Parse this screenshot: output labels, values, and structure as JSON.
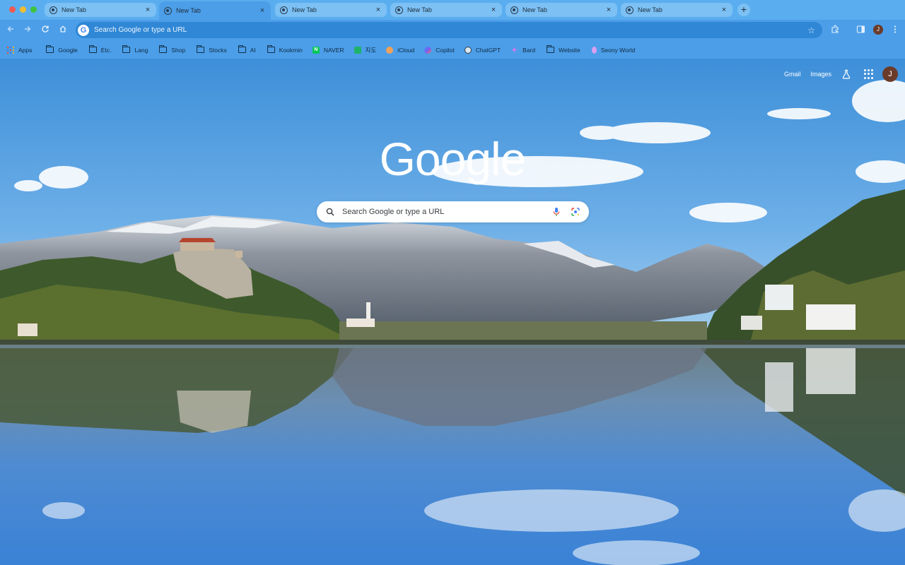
{
  "window": {
    "tabs": [
      {
        "title": "New Tab",
        "active": false
      },
      {
        "title": "New Tab",
        "active": true
      },
      {
        "title": "New Tab",
        "active": false
      },
      {
        "title": "New Tab",
        "active": false
      },
      {
        "title": "New Tab",
        "active": false
      },
      {
        "title": "New Tab",
        "active": false
      }
    ],
    "close_glyph": "×",
    "new_tab_glyph": "+"
  },
  "toolbar": {
    "omnibox_placeholder": "Search Google or type a URL",
    "omnibox_badge": "G",
    "profile_initial": "J"
  },
  "bookmarks": [
    {
      "label": "Apps",
      "icon": "apps-grid-icon"
    },
    {
      "label": "Google",
      "icon": "folder-icon"
    },
    {
      "label": "Etc.",
      "icon": "folder-icon"
    },
    {
      "label": "Lang",
      "icon": "folder-icon"
    },
    {
      "label": "Shop",
      "icon": "folder-icon"
    },
    {
      "label": "Stocks",
      "icon": "folder-icon"
    },
    {
      "label": "AI",
      "icon": "folder-icon"
    },
    {
      "label": "Kookmin",
      "icon": "folder-icon"
    },
    {
      "label": "NAVER",
      "icon": "naver-icon",
      "color": "#03c75a"
    },
    {
      "label": "지도",
      "icon": "naver-map-icon",
      "color": "#1fb26b"
    },
    {
      "label": "iCloud",
      "icon": "icloud-icon",
      "color": "#f0a25a"
    },
    {
      "label": "Copilot",
      "icon": "copilot-icon",
      "color": "#7a5cf0"
    },
    {
      "label": "ChatGPT",
      "icon": "chatgpt-icon",
      "color": "#2f3b45"
    },
    {
      "label": "Bard",
      "icon": "bard-icon",
      "color": "#c27cf0"
    },
    {
      "label": "Website",
      "icon": "folder-icon"
    },
    {
      "label": "Seony World",
      "icon": "seony-world-icon",
      "color": "#d9a0f0"
    }
  ],
  "ntp": {
    "links": {
      "gmail": "Gmail",
      "images": "Images"
    },
    "logo": "Google",
    "search_placeholder": "Search Google or type a URL",
    "profile_initial": "J"
  },
  "colors": {
    "chrome_frame": "#4c9ee8",
    "tab_strip": "#5aaef0",
    "omnibox_fill": "#2f87d6",
    "avatar": "#6b3b2a"
  }
}
